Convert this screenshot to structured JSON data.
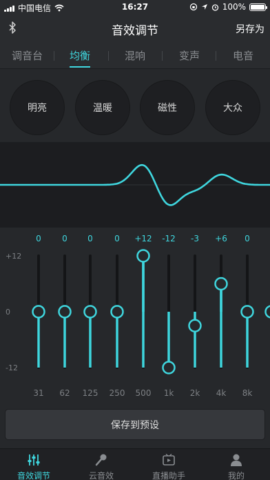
{
  "status_bar": {
    "carrier": "中国电信",
    "time": "16:27",
    "battery": "100%",
    "battery_level": 1.0
  },
  "nav": {
    "title": "音效调节",
    "save_as": "另存为",
    "bluetooth_icon": "bluetooth-icon"
  },
  "tabs": [
    {
      "label": "调音台",
      "active": false
    },
    {
      "label": "均衡",
      "active": true
    },
    {
      "label": "混响",
      "active": false
    },
    {
      "label": "变声",
      "active": false
    },
    {
      "label": "电音",
      "active": false
    }
  ],
  "presets": [
    {
      "label": "明亮"
    },
    {
      "label": "温暖"
    },
    {
      "label": "磁性"
    },
    {
      "label": "大众"
    }
  ],
  "equalizer": {
    "scale_labels": [
      "+12",
      "0",
      "-12"
    ],
    "range": [
      -12,
      12
    ],
    "bands": [
      {
        "freq": "31",
        "gain": 0,
        "gain_label": "0"
      },
      {
        "freq": "62",
        "gain": 0,
        "gain_label": "0"
      },
      {
        "freq": "125",
        "gain": 0,
        "gain_label": "0"
      },
      {
        "freq": "250",
        "gain": 0,
        "gain_label": "0"
      },
      {
        "freq": "500",
        "gain": 12,
        "gain_label": "+12"
      },
      {
        "freq": "1k",
        "gain": -12,
        "gain_label": "-12"
      },
      {
        "freq": "2k",
        "gain": -3,
        "gain_label": "-3"
      },
      {
        "freq": "4k",
        "gain": 6,
        "gain_label": "+6"
      },
      {
        "freq": "8k",
        "gain": 0,
        "gain_label": "0"
      },
      {
        "freq": "",
        "gain": 0,
        "gain_label": ""
      }
    ]
  },
  "actions": {
    "save_preset": "保存到预设"
  },
  "tab_bar": [
    {
      "label": "音效调节",
      "icon": "sliders-icon",
      "active": true
    },
    {
      "label": "云音效",
      "icon": "microphone-icon",
      "active": false
    },
    {
      "label": "直播助手",
      "icon": "play-box-icon",
      "active": false
    },
    {
      "label": "我的",
      "icon": "person-icon",
      "active": false
    }
  ],
  "colors": {
    "accent": "#3fd6de",
    "background": "#26282b",
    "curve_background": "#1c1d20",
    "inactive_text": "#8a8d91"
  }
}
